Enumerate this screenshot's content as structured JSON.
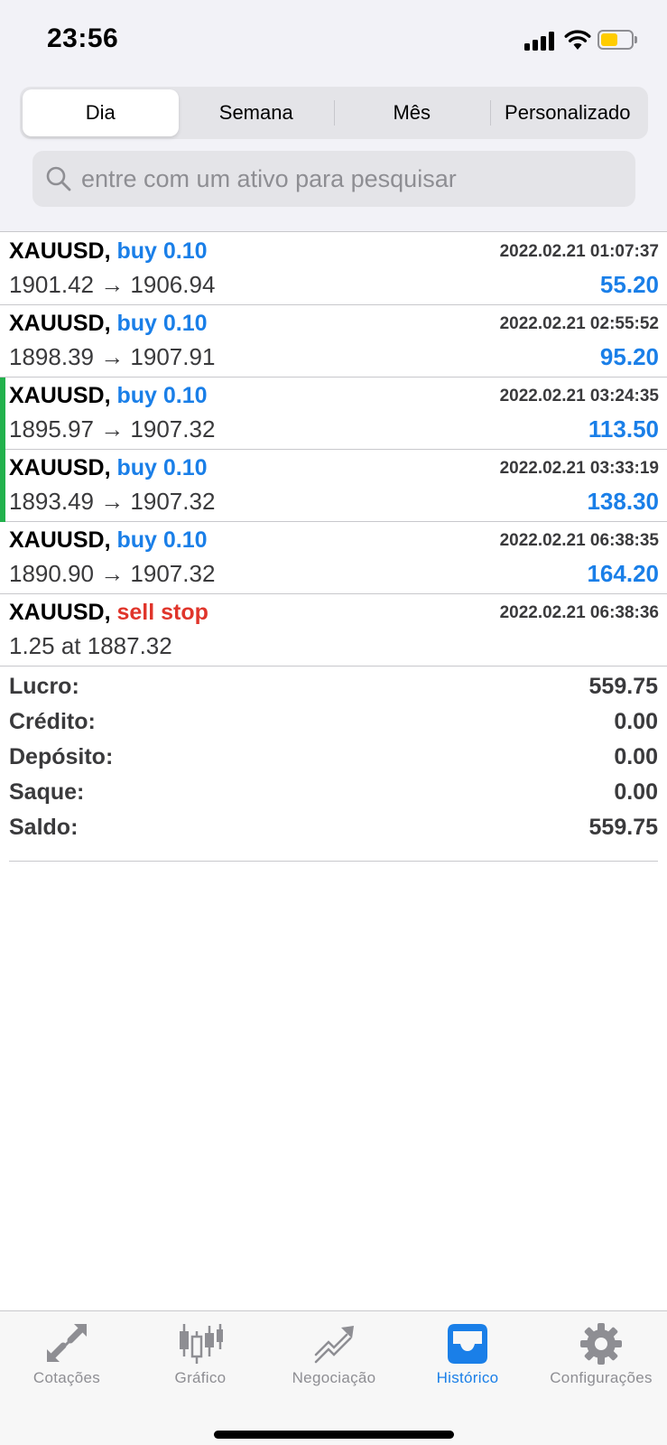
{
  "status_bar": {
    "time": "23:56"
  },
  "segments": [
    {
      "label": "Dia",
      "active": true
    },
    {
      "label": "Semana",
      "active": false
    },
    {
      "label": "Mês",
      "active": false
    },
    {
      "label": "Personalizado",
      "active": false
    }
  ],
  "search": {
    "placeholder": "entre com um ativo para pesquisar"
  },
  "orders": [
    {
      "symbol": "XAUUSD,",
      "side": "buy 0.10",
      "time": "2022.02.21 01:07:37",
      "prices": "1901.42 → 1906.94",
      "profit": "55.20"
    },
    {
      "symbol": "XAUUSD,",
      "side": "buy 0.10",
      "time": "2022.02.21 02:55:52",
      "prices": "1898.39 → 1907.91",
      "profit": "95.20"
    },
    {
      "symbol": "XAUUSD,",
      "side": "buy 0.10",
      "time": "2022.02.21 03:24:35",
      "prices": "1895.97 → 1907.32",
      "profit": "113.50"
    },
    {
      "symbol": "XAUUSD,",
      "side": "buy 0.10",
      "time": "2022.02.21 03:33:19",
      "prices": "1893.49 → 1907.32",
      "profit": "138.30"
    },
    {
      "symbol": "XAUUSD,",
      "side": "buy 0.10",
      "time": "2022.02.21 06:38:35",
      "prices": "1890.90 → 1907.32",
      "profit": "164.20"
    },
    {
      "symbol": "XAUUSD,",
      "side": "sell stop",
      "time": "2022.02.21 06:38:36",
      "prices": "1.25 at 1887.32",
      "profit": ""
    }
  ],
  "summary": [
    {
      "label": "Lucro:",
      "value": "559.75"
    },
    {
      "label": "Crédito:",
      "value": "0.00"
    },
    {
      "label": "Depósito:",
      "value": "0.00"
    },
    {
      "label": "Saque:",
      "value": "0.00"
    },
    {
      "label": "Saldo:",
      "value": "559.75"
    }
  ],
  "tabs": [
    {
      "label": "Cotações",
      "icon": "quotes-arrows-icon",
      "active": false
    },
    {
      "label": "Gráfico",
      "icon": "candlestick-chart-icon",
      "active": false
    },
    {
      "label": "Negociação",
      "icon": "trade-trend-icon",
      "active": false
    },
    {
      "label": "Histórico",
      "icon": "history-inbox-icon",
      "active": true
    },
    {
      "label": "Configurações",
      "icon": "gear-icon",
      "active": false
    }
  ],
  "colors": {
    "accent_blue": "#1a7fe8",
    "sell_red": "#e0352b",
    "row_marker_green": "#22b14c",
    "battery_yellow": "#ffcc00"
  }
}
